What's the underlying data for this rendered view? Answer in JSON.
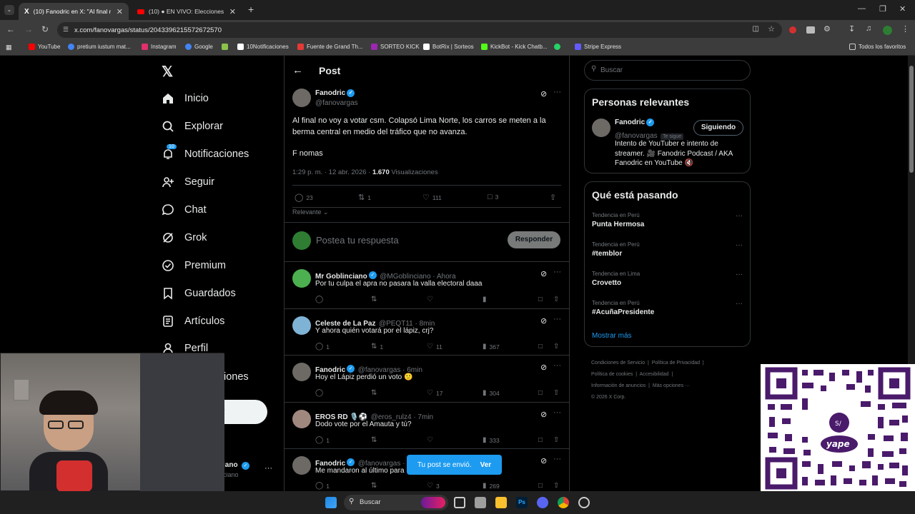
{
  "tabs": [
    {
      "label": "(10) Fanodric en X: \"Al final no v",
      "active": true
    },
    {
      "label": "(10) ● EN VIVO: Elecciones Ge",
      "active": false
    }
  ],
  "address": {
    "url": "x.com/fanovargas/status/2043396215572672570"
  },
  "bookmarks": [
    {
      "label": "YouTube",
      "color": "#ff0000"
    },
    {
      "label": "pretium iustum mat...",
      "color": "#4285f4"
    },
    {
      "label": "Instagram",
      "color": "#e1306c"
    },
    {
      "label": "Google",
      "color": "#4285f4"
    },
    {
      "label": "",
      "color": "#8bc34a"
    },
    {
      "label": "10Notificaciones",
      "color": "#ffffff"
    },
    {
      "label": "Fuente de Grand Th...",
      "color": "#e53935"
    },
    {
      "label": "SORTEO KICK",
      "color": "#9c27b0"
    },
    {
      "label": "BotRix | Sorteos",
      "color": "#ffffff"
    },
    {
      "label": "KickBot - Kick Chatb...",
      "color": "#53fc18"
    },
    {
      "label": "",
      "color": "#25d366"
    },
    {
      "label": "Stripe Express",
      "color": "#635bff"
    }
  ],
  "bookmarks_all": "Todos los favoritos",
  "nav": {
    "items": [
      {
        "label": "Inicio",
        "icon": "home-icon"
      },
      {
        "label": "Explorar",
        "icon": "search-icon"
      },
      {
        "label": "Notificaciones",
        "icon": "bell-icon",
        "badge": "10"
      },
      {
        "label": "Seguir",
        "icon": "follow-icon"
      },
      {
        "label": "Chat",
        "icon": "chat-icon"
      },
      {
        "label": "Grok",
        "icon": "grok-icon"
      },
      {
        "label": "Premium",
        "icon": "premium-icon"
      },
      {
        "label": "Guardados",
        "icon": "bookmark-icon"
      },
      {
        "label": "Artículos",
        "icon": "article-icon"
      },
      {
        "label": "Perfil",
        "icon": "profile-icon"
      }
    ],
    "more_partial": "iones",
    "post_button_partial": "r",
    "account_partial": "iano",
    "account_handle_partial": "ciano"
  },
  "post": {
    "header_title": "Post",
    "author": "Fanodric",
    "handle": "@fanovargas",
    "text": "Al final no voy a votar csm. Colapsó Lima Norte, los carros se meten a la berma central en medio del tráfico que no avanza.",
    "text2": "F nomas",
    "timestamp": "1:29 p. m. · 12 abr. 2026 ·",
    "views_count": "1.670",
    "views_label": "Visualizaciones",
    "replies": "23",
    "reposts": "1",
    "likes": "111",
    "bookmarks": "3",
    "sort": "Relevante",
    "reply_placeholder": "Postea tu respuesta",
    "reply_button": "Responder"
  },
  "replies": [
    {
      "name": "Mr Goblinciano",
      "handle": "@MGoblinciano · Ahora",
      "text": "Por tu culpa el apra no pasara la valla electoral daaa",
      "replies": "",
      "reposts": "",
      "likes": "",
      "views": ""
    },
    {
      "name": "Celeste de La Paz",
      "handle": "@PEQT11 · 8min",
      "text": "Y ahora quién votará por el lápiz, crj?",
      "replies": "1",
      "reposts": "1",
      "likes": "11",
      "views": "367"
    },
    {
      "name": "Fanodric",
      "handle": "@fanovargas · 6min",
      "text": "Hoy el Lápiz perdió un voto 🙁",
      "replies": "",
      "reposts": "",
      "likes": "17",
      "views": "304"
    },
    {
      "name": "EROS RD 🎙️⚽",
      "handle": "@eros_rulz4 · 7min",
      "text": "Dodo vote por el Amauta y tú?",
      "replies": "1",
      "reposts": "",
      "likes": "",
      "views": "333"
    },
    {
      "name": "Fanodric",
      "handle": "@fanovargas ·",
      "text": "Me mandaron al último para",
      "replies": "1",
      "reposts": "",
      "likes": "3",
      "views": "269"
    }
  ],
  "toast": {
    "text": "Tu post se envió.",
    "link": "Ver"
  },
  "search": {
    "placeholder": "Buscar"
  },
  "relevant": {
    "title": "Personas relevantes",
    "name": "Fanodric",
    "handle": "@fanovargas",
    "follows_you": "Te sigue",
    "follow_button": "Siguiendo",
    "bio": "Intento de YouTuber e intento de streamer. 🎥 Fanodric Podcast / AKA Fanodric en YouTube 🔇"
  },
  "trends": {
    "title": "Qué está pasando",
    "items": [
      {
        "context": "Tendencia en Perú",
        "topic": "Punta Hermosa"
      },
      {
        "context": "Tendencia en Perú",
        "topic": "#temblor"
      },
      {
        "context": "Tendencia en Lima",
        "topic": "Crovetto"
      },
      {
        "context": "Tendencia en Perú",
        "topic": "#AcuñaPresidente"
      }
    ],
    "more": "Mostrar más"
  },
  "footer": {
    "l1a": "Condiciones de Servicio",
    "l1b": "Política de Privacidad",
    "l2a": "Política de cookies",
    "l2b": "Accesibilidad",
    "l3a": "Información de anuncios",
    "l3b": "Más opciones ···",
    "copyright": "© 2026 X Corp."
  },
  "taskbar": {
    "search": "Buscar"
  },
  "colors": {
    "accent": "#1d9bf0",
    "qr": "#4a1a6b",
    "bg": "#000000"
  }
}
